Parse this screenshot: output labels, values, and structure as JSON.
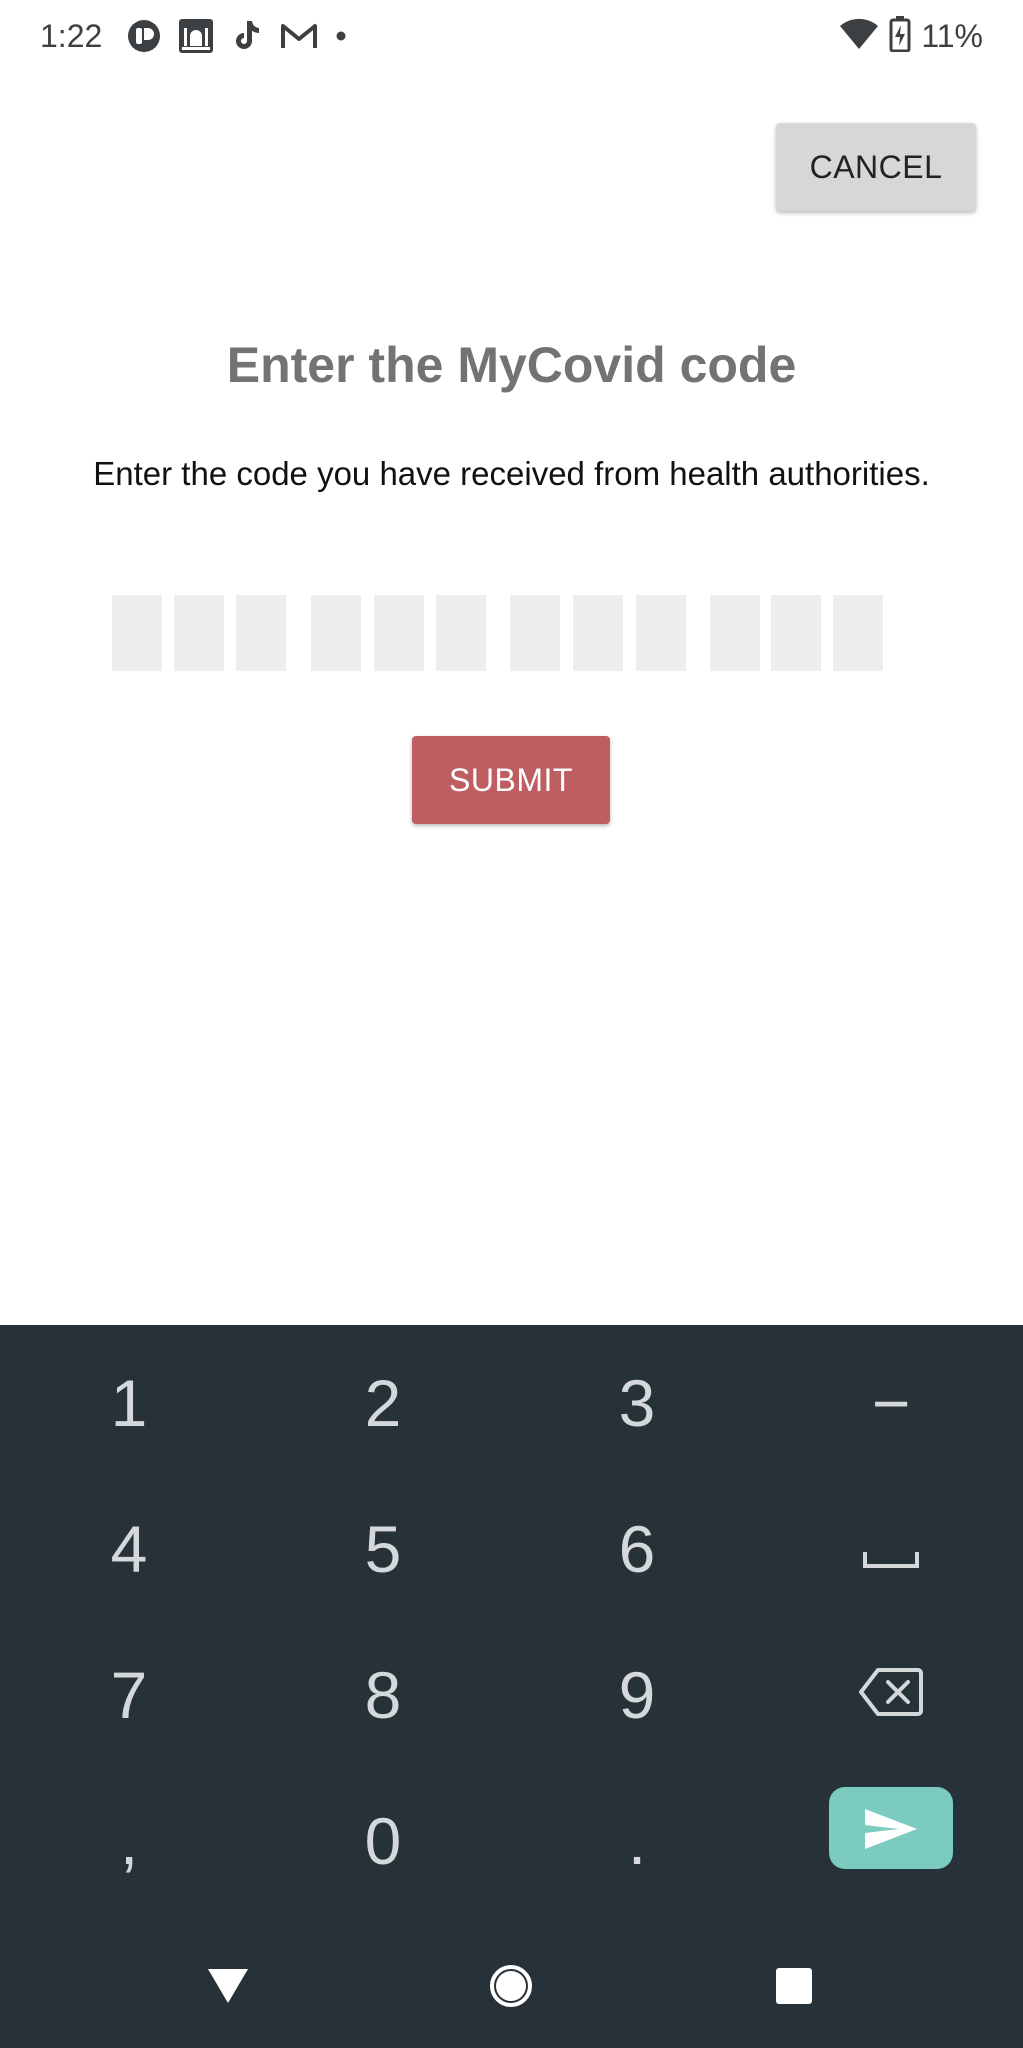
{
  "status_bar": {
    "time": "1:22",
    "battery": "11%",
    "notification_icons": [
      "fluent-icon",
      "mosque-icon",
      "tiktok-icon",
      "gmail-icon",
      "more-dot-icon"
    ],
    "system_icons": [
      "wifi-icon",
      "battery-charging-icon"
    ]
  },
  "header": {
    "cancel_label": "CANCEL"
  },
  "main": {
    "title": "Enter the MyCovid code",
    "description": "Enter the code you have received from health authorities.",
    "code_length": 12,
    "code_values": [
      "",
      "",
      "",
      "",
      "",
      "",
      "",
      "",
      "",
      "",
      "",
      ""
    ],
    "submit_label": "SUBMIT"
  },
  "keyboard": {
    "rows": [
      [
        "1",
        "2",
        "3",
        "−"
      ],
      [
        "4",
        "5",
        "6",
        "space-icon"
      ],
      [
        "7",
        "8",
        "9",
        "backspace-icon"
      ],
      [
        ",",
        "0",
        ".",
        "send-icon"
      ]
    ]
  },
  "nav_bar": {
    "buttons": [
      "back-icon",
      "home-icon",
      "recents-icon"
    ]
  },
  "colors": {
    "accent": "#bf5e62",
    "keyboard_bg": "#263238",
    "enter_key": "#7ccbc0",
    "title_gray": "#737373",
    "cancel_bg": "#d6d7d7",
    "code_box_bg": "#eeeeee"
  }
}
